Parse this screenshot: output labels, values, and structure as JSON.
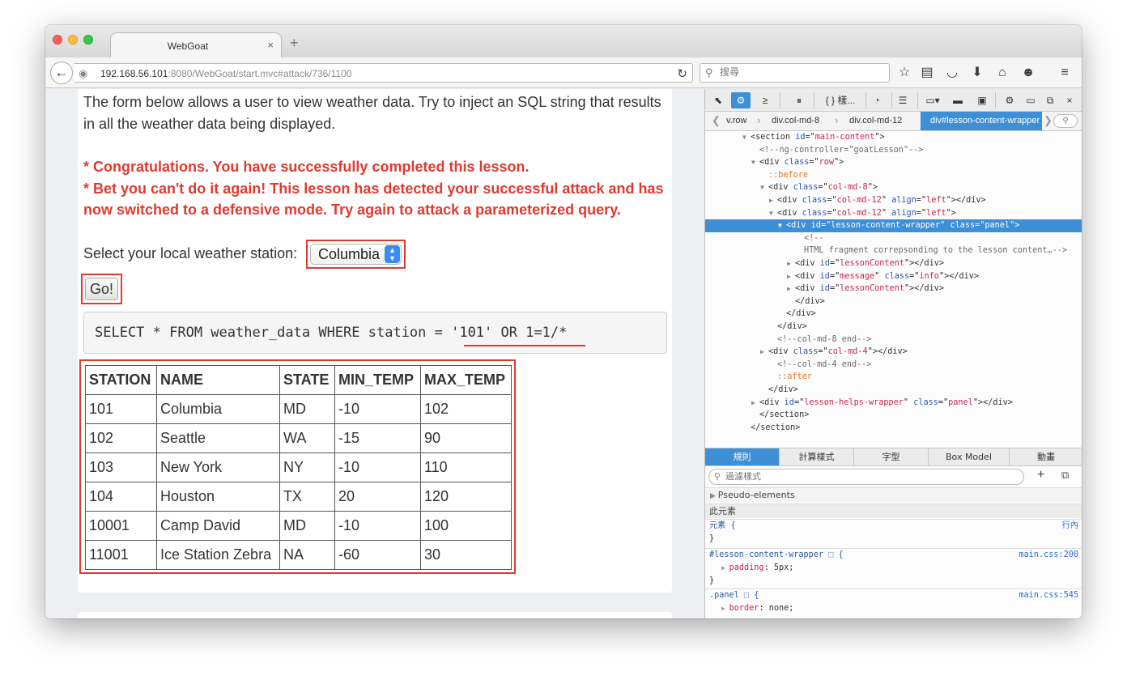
{
  "browser": {
    "tab_title": "WebGoat",
    "tab_close": "×",
    "new_tab": "+",
    "url_host": "192.168.56.101",
    "url_path": ":8080/WebGoat/start.mvc#attack/736/1100",
    "search_placeholder": "搜尋"
  },
  "lesson": {
    "intro": "The form below allows a user to view weather data. Try to inject an SQL string that results in all the weather data being displayed.",
    "success_line1": "* Congratulations. You have successfully completed this lesson.",
    "success_line2": "* Bet you can't do it again! This lesson has detected your successful attack and has now switched to a defensive mode. Try again to attack a parameterized query.",
    "station_label": "Select your local weather station:",
    "station_selected": "Columbia",
    "go_label": "Go!",
    "sql_query": "SELECT * FROM weather_data WHERE station = '101' OR 1=1/*"
  },
  "weather_table": {
    "headers": [
      "STATION",
      "NAME",
      "STATE",
      "MIN_TEMP",
      "MAX_TEMP"
    ],
    "rows": [
      [
        "101",
        "Columbia",
        "MD",
        "-10",
        "102"
      ],
      [
        "102",
        "Seattle",
        "WA",
        "-15",
        "90"
      ],
      [
        "103",
        "New York",
        "NY",
        "-10",
        "110"
      ],
      [
        "104",
        "Houston",
        "TX",
        "20",
        "120"
      ],
      [
        "10001",
        "Camp David",
        "MD",
        "-10",
        "100"
      ],
      [
        "11001",
        "Ice Station Zebra",
        "NA",
        "-60",
        "30"
      ]
    ]
  },
  "devtools": {
    "toolbar_more": "{ } 樣...",
    "breadcrumbs": [
      "v.row",
      "div.col-md-8",
      "div.col-md-12",
      "div#lesson-content-wrapper"
    ],
    "tree": [
      {
        "indent": 4,
        "tw": "▼",
        "html": "<span class='t-tag'>&lt;section </span><span class='t-attr'>id</span>=\"<span class='t-val'>main-content</span>\"<span class='t-tag'>&gt;</span>"
      },
      {
        "indent": 5,
        "tw": "",
        "html": "<span class='t-com'>&lt;!--ng-controller=\"goatLesson\"--&gt;</span>"
      },
      {
        "indent": 5,
        "tw": "▼",
        "html": "<span class='t-tag'>&lt;div </span><span class='t-attr'>class</span>=\"<span class='t-val'>row</span>\"<span class='t-tag'>&gt;</span>"
      },
      {
        "indent": 6,
        "tw": "",
        "html": "<span class='t-pseudo'>::before</span>"
      },
      {
        "indent": 6,
        "tw": "▼",
        "html": "<span class='t-tag'>&lt;div </span><span class='t-attr'>class</span>=\"<span class='t-val'>col-md-8</span>\"<span class='t-tag'>&gt;</span>"
      },
      {
        "indent": 7,
        "tw": "▶",
        "html": "<span class='t-tag'>&lt;div </span><span class='t-attr'>class</span>=\"<span class='t-val'>col-md-12</span>\" <span class='t-attr'>align</span>=\"<span class='t-val'>left</span>\"<span class='t-tag'>&gt;&lt;/div&gt;</span>"
      },
      {
        "indent": 7,
        "tw": "▼",
        "html": "<span class='t-tag'>&lt;div </span><span class='t-attr'>class</span>=\"<span class='t-val'>col-md-12</span>\" <span class='t-attr'>align</span>=\"<span class='t-val'>left</span>\"<span class='t-tag'>&gt;</span>"
      },
      {
        "indent": 8,
        "tw": "▼",
        "sel": true,
        "html": "<span class='t-tag'>&lt;div </span><span class='t-attr'>id</span>=\"<span class='t-val'>lesson-content-wrapper</span>\" <span class='t-attr'>class</span>=\"<span class='t-val'>panel</span>\"<span class='t-tag'>&gt;</span>"
      },
      {
        "indent": 10,
        "tw": "",
        "html": "<span class='t-com'>&lt;!--</span>"
      },
      {
        "indent": 10,
        "tw": "",
        "html": "<span class='t-com'>HTML fragment correpsonding to the lesson content…--&gt;</span>"
      },
      {
        "indent": 9,
        "tw": "▶",
        "html": "<span class='t-tag'>&lt;div </span><span class='t-attr'>id</span>=\"<span class='t-val'>lessonContent</span>\"<span class='t-tag'>&gt;&lt;/div&gt;</span>"
      },
      {
        "indent": 9,
        "tw": "▶",
        "html": "<span class='t-tag'>&lt;div </span><span class='t-attr'>id</span>=\"<span class='t-val'>message</span>\" <span class='t-attr'>class</span>=\"<span class='t-val'>info</span>\"<span class='t-tag'>&gt;&lt;/div&gt;</span>"
      },
      {
        "indent": 9,
        "tw": "▶",
        "html": "<span class='t-tag'>&lt;div </span><span class='t-attr'>id</span>=\"<span class='t-val'>lessonContent</span>\"<span class='t-tag'>&gt;&lt;/div&gt;</span>"
      },
      {
        "indent": 9,
        "tw": "",
        "html": "<span class='t-tag'>&lt;/div&gt;</span>"
      },
      {
        "indent": 8,
        "tw": "",
        "html": "<span class='t-tag'>&lt;/div&gt;</span>"
      },
      {
        "indent": 7,
        "tw": "",
        "html": "<span class='t-tag'>&lt;/div&gt;</span>"
      },
      {
        "indent": 7,
        "tw": "",
        "html": "<span class='t-com'>&lt;!--col-md-8 end--&gt;</span>"
      },
      {
        "indent": 6,
        "tw": "▶",
        "html": "<span class='t-tag'>&lt;div </span><span class='t-attr'>class</span>=\"<span class='t-val'>col-md-4</span>\"<span class='t-tag'>&gt;&lt;/div&gt;</span>"
      },
      {
        "indent": 7,
        "tw": "",
        "html": "<span class='t-com'>&lt;!--col-md-4 end--&gt;</span>"
      },
      {
        "indent": 7,
        "tw": "",
        "html": "<span class='t-pseudo'>::after</span>"
      },
      {
        "indent": 6,
        "tw": "",
        "html": "<span class='t-tag'>&lt;/div&gt;</span>"
      },
      {
        "indent": 5,
        "tw": "▶",
        "html": "<span class='t-tag'>&lt;div </span><span class='t-attr'>id</span>=\"<span class='t-val'>lesson-helps-wrapper</span>\" <span class='t-attr'>class</span>=\"<span class='t-val'>panel</span>\"<span class='t-tag'>&gt;&lt;/div&gt;</span>"
      },
      {
        "indent": 5,
        "tw": "",
        "html": "<span class='t-tag'>&lt;/section&gt;</span>"
      },
      {
        "indent": 4,
        "tw": "",
        "html": "<span class='t-tag'>&lt;/section&gt;</span>"
      }
    ],
    "panel_tabs": [
      "規則",
      "計算樣式",
      "字型",
      "Box Model",
      "動畫"
    ],
    "filter_placeholder": "過濾樣式",
    "pseudo_elements": "Pseudo-elements",
    "this_element": "此元素",
    "rule1_selector": "元素 {",
    "rule1_source": "行內",
    "rule2_selector": "#lesson-content-wrapper ⬚ {",
    "rule2_source": "main.css:200",
    "rule2_prop": "padding",
    "rule2_value": "5px;",
    "rule3_selector": ".panel ⬚ {",
    "rule3_source": "main.css:545",
    "rule3_prop": "border",
    "rule3_value": "none;",
    "close_brace": "}"
  }
}
